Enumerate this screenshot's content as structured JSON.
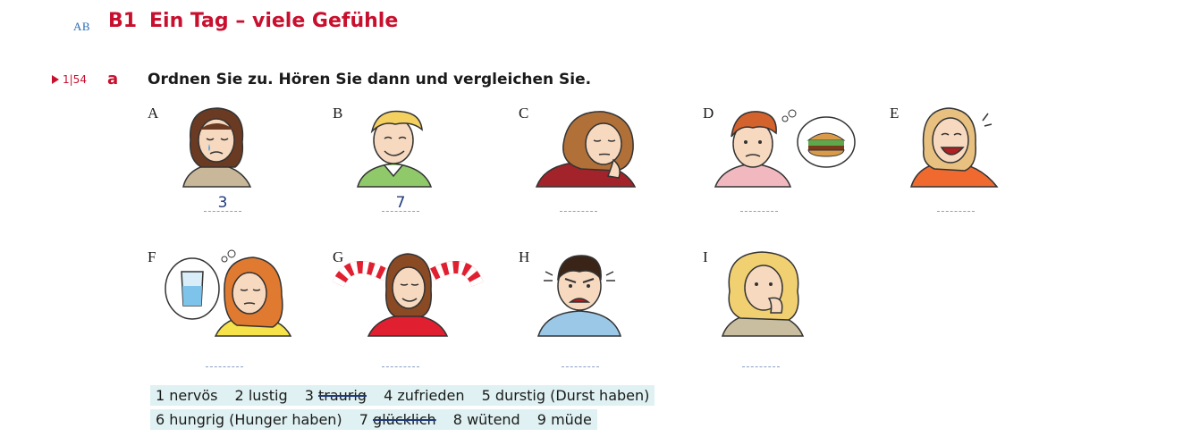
{
  "header": {
    "ab_tag": "AB",
    "section_code": "B1",
    "title": "Ein Tag – viele Gefühle"
  },
  "task": {
    "track": "1|54",
    "letter": "a",
    "instruction": "Ordnen Sie zu. Hören Sie dann und vergleichen Sie."
  },
  "pictures": [
    {
      "letter": "A",
      "answer": "3"
    },
    {
      "letter": "B",
      "answer": "7"
    },
    {
      "letter": "C",
      "answer": ""
    },
    {
      "letter": "D",
      "answer": ""
    },
    {
      "letter": "E",
      "answer": ""
    },
    {
      "letter": "F",
      "answer": ""
    },
    {
      "letter": "G",
      "answer": ""
    },
    {
      "letter": "H",
      "answer": ""
    },
    {
      "letter": "I",
      "answer": ""
    }
  ],
  "word_bank": {
    "line1": [
      {
        "num": "1",
        "word": "nervös",
        "struck": false
      },
      {
        "num": "2",
        "word": "lustig",
        "struck": false
      },
      {
        "num": "3",
        "word": "traurig",
        "struck": true
      },
      {
        "num": "4",
        "word": "zufrieden",
        "struck": false
      },
      {
        "num": "5",
        "word": "durstig (Durst haben)",
        "struck": false
      }
    ],
    "line2": [
      {
        "num": "6",
        "word": "hungrig (Hunger haben)",
        "struck": false
      },
      {
        "num": "7",
        "word": "glücklich",
        "struck": true
      },
      {
        "num": "8",
        "word": "wütend",
        "struck": false
      },
      {
        "num": "9",
        "word": "müde",
        "struck": false
      }
    ]
  },
  "colors": {
    "accent_red": "#c8102e",
    "handwriting_blue": "#203a7a",
    "bank_bg": "#dff1f2"
  }
}
